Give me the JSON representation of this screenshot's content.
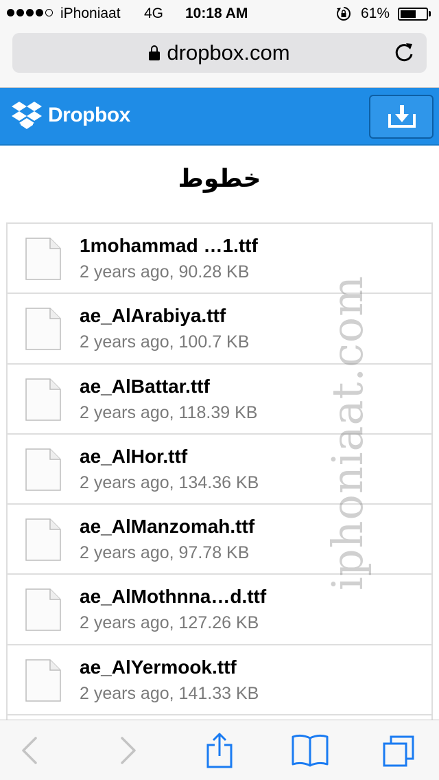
{
  "status_bar": {
    "carrier": "iPhoniaat",
    "network": "4G",
    "time": "10:18 AM",
    "battery_percent": "61%",
    "battery_level": 0.61,
    "signal_bars": 4,
    "signal_total": 5,
    "icons": [
      "rotation-lock-icon",
      "battery-icon"
    ]
  },
  "address_bar": {
    "url": "dropbox.com",
    "icons": [
      "lock-icon",
      "reload-icon"
    ]
  },
  "header": {
    "logo_text": "Dropbox",
    "brand_color": "#1f8ce6",
    "icons": [
      "dropbox-logo-icon",
      "download-icon"
    ]
  },
  "folder": {
    "title": "خطوط"
  },
  "files": [
    {
      "name": "1mohammad …1.ttf",
      "meta": "2 years ago, 90.28 KB"
    },
    {
      "name": "ae_AlArabiya.ttf",
      "meta": "2 years ago, 100.7 KB"
    },
    {
      "name": "ae_AlBattar.ttf",
      "meta": "2 years ago, 118.39 KB"
    },
    {
      "name": "ae_AlHor.ttf",
      "meta": "2 years ago, 134.36 KB"
    },
    {
      "name": "ae_AlManzomah.ttf",
      "meta": "2 years ago, 97.78 KB"
    },
    {
      "name": "ae_AlMothnna…d.ttf",
      "meta": "2 years ago, 127.26 KB"
    },
    {
      "name": "ae_AlYermook.ttf",
      "meta": "2 years ago, 141.33 KB"
    }
  ],
  "watermark": "iphoniaat.com",
  "toolbar": {
    "icons": [
      "back-icon",
      "forward-icon",
      "share-icon",
      "bookmarks-icon",
      "tabs-icon"
    ],
    "accent_color": "#1a7bf2"
  }
}
